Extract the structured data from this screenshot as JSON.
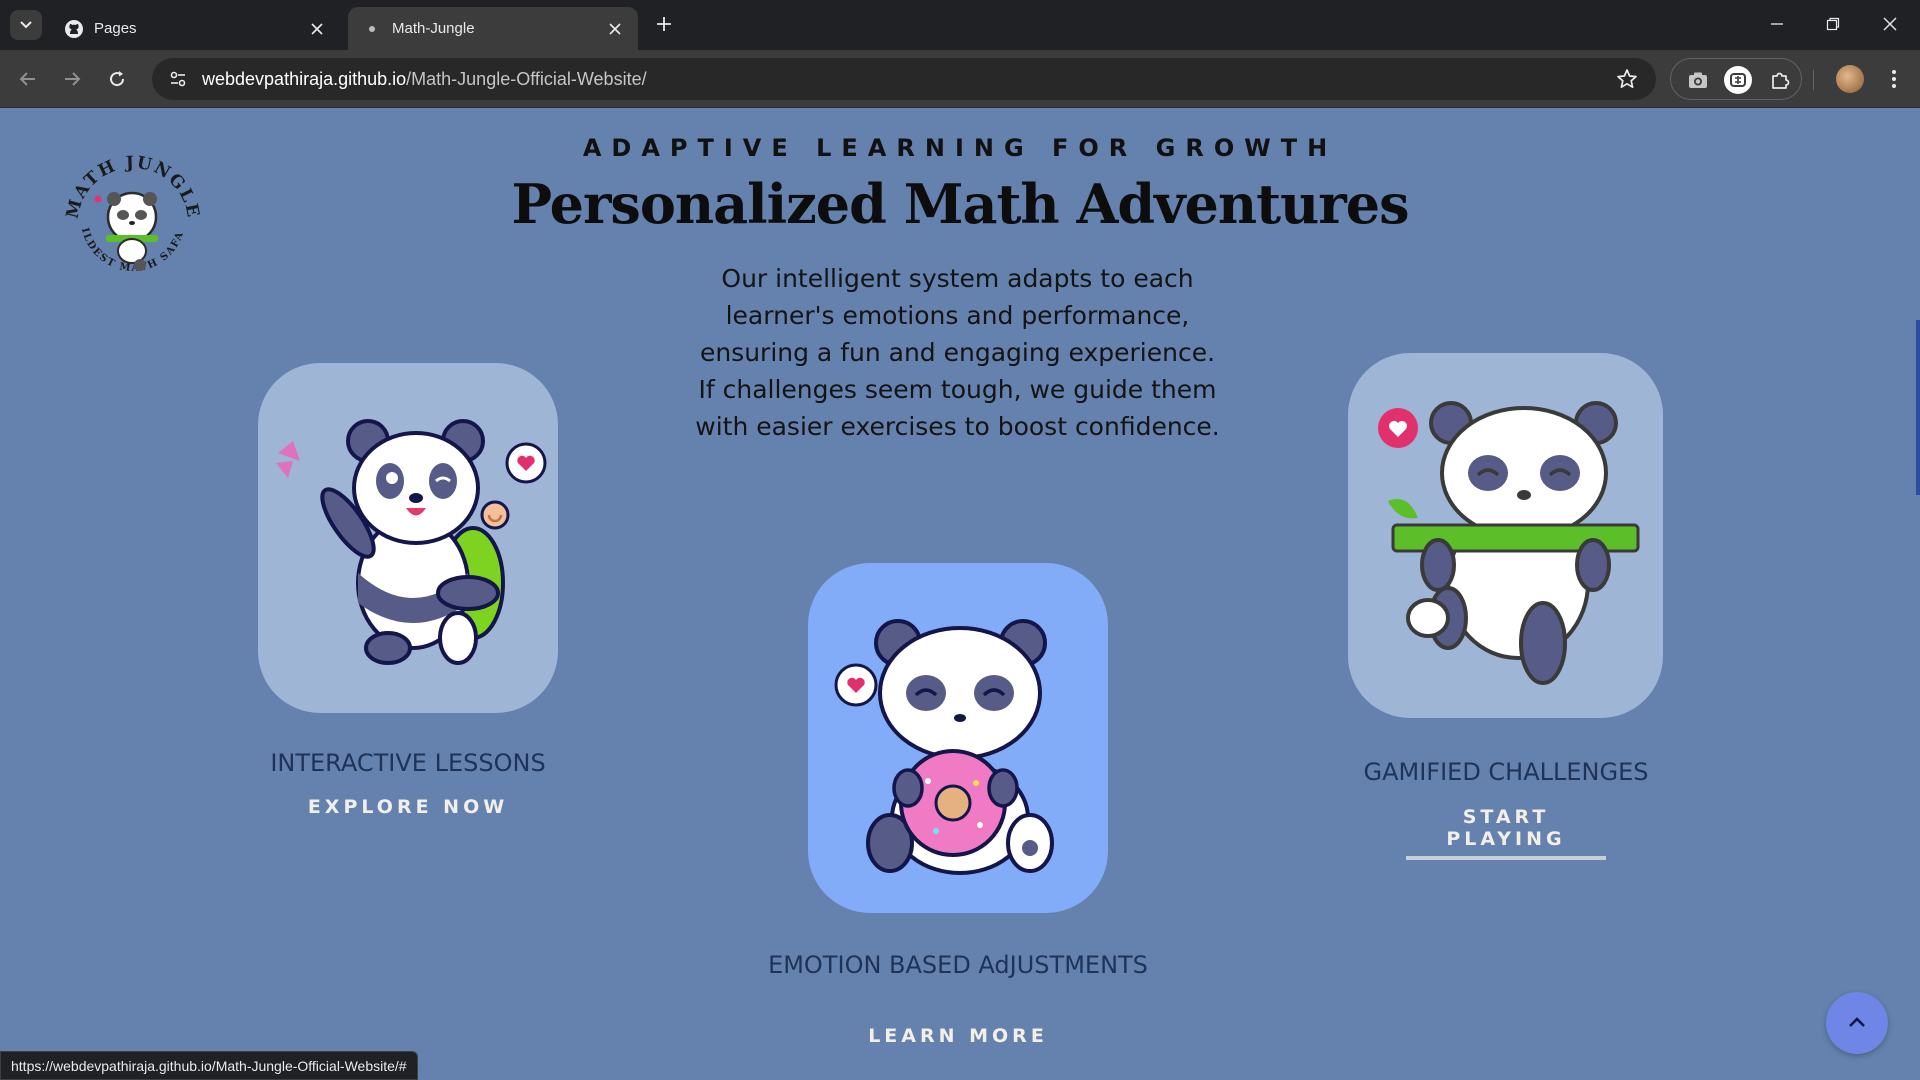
{
  "browser": {
    "tabs": [
      {
        "title": "Pages",
        "favicon": "github-icon",
        "active": false
      },
      {
        "title": "Math-Jungle",
        "favicon": "page-icon",
        "active": true
      }
    ],
    "url_host": "webdevpathiraja.github.io",
    "url_path": "/Math-Jungle-Official-Website/",
    "status_url": "https://webdevpathiraja.github.io/Math-Jungle-Official-Website/#"
  },
  "logo": {
    "name": "math-jungle-logo",
    "arc_top": "MATH JUNGLE",
    "arc_bottom": "WILDEST MATH SAFARI"
  },
  "hero": {
    "eyebrow": "ADAPTIVE LEARNING FOR GROWTH",
    "headline": "Personalized Math Adventures",
    "intro": "Our intelligent system adapts to each learner's emotions and performance, ensuring a fun and engaging experience. If challenges seem tough, we guide them with easier exercises to boost confidence."
  },
  "features": [
    {
      "title": "INTERACTIVE LESSONS",
      "link": "EXPLORE NOW",
      "illustration": "panda-backpack-butterfly"
    },
    {
      "title": "EMOTION BASED AdJUSTMENTS",
      "link": "LEARN MORE",
      "illustration": "panda-eating-donut"
    },
    {
      "title": "GAMIFIED CHALLENGES",
      "link": "START PLAYING",
      "illustration": "panda-bamboo-scarf"
    }
  ],
  "colors": {
    "page_background": "#6482ad",
    "card_light": "#9fb5d5",
    "card_blue": "#82acf7",
    "feature_title": "#1f3359",
    "to_top_button": "#6f86e6"
  }
}
